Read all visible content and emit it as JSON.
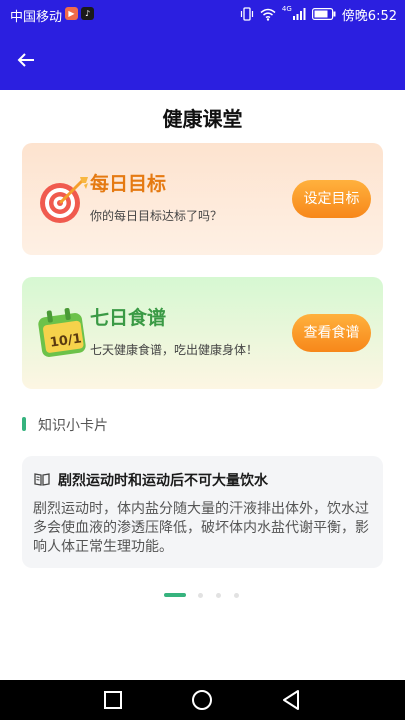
{
  "status_bar": {
    "carrier": "中国移动",
    "time": "傍晚6:52",
    "signal_label": "4G",
    "background": "#2b1fe0"
  },
  "header": {
    "back_icon": "arrow-left-icon",
    "background": "#2b1fe0"
  },
  "page": {
    "title": "健康课堂"
  },
  "cards": [
    {
      "icon": "target-dart-icon",
      "title": "每日目标",
      "subtitle": "你的每日目标达标了吗？",
      "button": "设定目标",
      "title_color": "#e57a12"
    },
    {
      "icon": "calendar-icon",
      "title": "七日食谱",
      "subtitle": "七天健康食谱，吃出健康身体！",
      "button": "查看食谱",
      "title_color": "#3a9a45"
    }
  ],
  "knowledge": {
    "section_title": "知识小卡片",
    "tip": {
      "icon": "book-icon",
      "title": "剧烈运动时和运动后不可大量饮水",
      "body": "剧烈运动时，体内盐分随大量的汗液排出体外，饮水过多会使血液的渗透压降低，破坏体内水盐代谢平衡，影响人体正常生理功能。"
    },
    "pager": {
      "total": 4,
      "active": 1
    }
  },
  "accent_color": "#36b37e",
  "button_color": "#f7871a"
}
